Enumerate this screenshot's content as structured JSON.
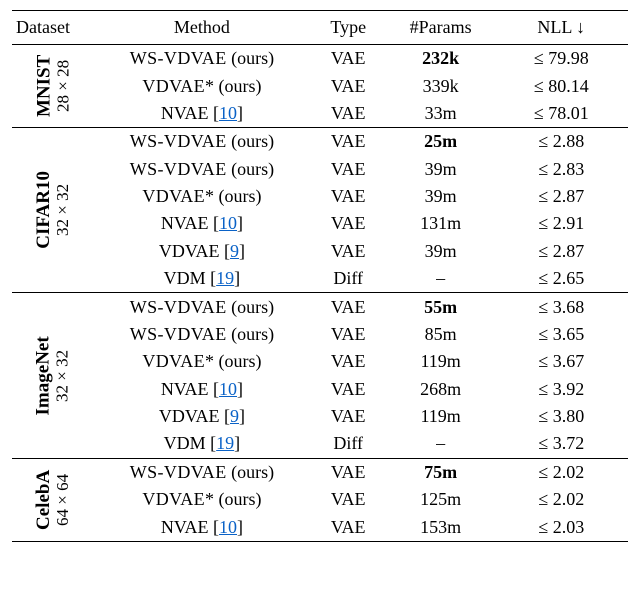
{
  "headers": {
    "dataset": "Dataset",
    "method": "Method",
    "type": "Type",
    "params": "#Params",
    "nll": "NLL ↓"
  },
  "cites": {
    "c9": "9",
    "c10": "10",
    "c19": "19"
  },
  "groups": [
    {
      "name": "MNIST",
      "size": "28 × 28",
      "rows": [
        {
          "method_prefix": "",
          "method_sc": "WS-VDVAE",
          "method_suffix": " (ours)",
          "cite": null,
          "type": "VAE",
          "params": "232k",
          "params_bold": true,
          "nll": "≤ 79.98"
        },
        {
          "method_prefix": "",
          "method_sc": "VDVAE",
          "method_suffix": "* (ours)",
          "cite": null,
          "type": "VAE",
          "params": "339k",
          "params_bold": false,
          "nll": "≤ 80.14"
        },
        {
          "method_prefix": "NVAE [",
          "method_sc": "",
          "method_suffix": "]",
          "cite": "c10",
          "type": "VAE",
          "params": "33m",
          "params_bold": false,
          "nll": "≤ 78.01"
        }
      ]
    },
    {
      "name": "CIFAR10",
      "size": "32 × 32",
      "rows": [
        {
          "method_prefix": "",
          "method_sc": "WS-VDVAE",
          "method_suffix": " (ours)",
          "cite": null,
          "type": "VAE",
          "params": "25m",
          "params_bold": true,
          "nll": "≤ 2.88"
        },
        {
          "method_prefix": "",
          "method_sc": "WS-VDVAE",
          "method_suffix": " (ours)",
          "cite": null,
          "type": "VAE",
          "params": "39m",
          "params_bold": false,
          "nll": "≤ 2.83"
        },
        {
          "method_prefix": "",
          "method_sc": "VDVAE",
          "method_suffix": "* (ours)",
          "cite": null,
          "type": "VAE",
          "params": "39m",
          "params_bold": false,
          "nll": "≤ 2.87"
        },
        {
          "method_prefix": "NVAE [",
          "method_sc": "",
          "method_suffix": "]",
          "cite": "c10",
          "type": "VAE",
          "params": "131m",
          "params_bold": false,
          "nll": "≤ 2.91"
        },
        {
          "method_prefix": "VDVAE [",
          "method_sc": "",
          "method_suffix": "]",
          "cite": "c9",
          "type": "VAE",
          "params": "39m",
          "params_bold": false,
          "nll": "≤ 2.87"
        },
        {
          "method_prefix": "VDM [",
          "method_sc": "",
          "method_suffix": "]",
          "cite": "c19",
          "type": "Diff",
          "params": "–",
          "params_bold": false,
          "nll": "≤ 2.65"
        }
      ]
    },
    {
      "name": "ImageNet",
      "size": "32 × 32",
      "rows": [
        {
          "method_prefix": "",
          "method_sc": "WS-VDVAE",
          "method_suffix": " (ours)",
          "cite": null,
          "type": "VAE",
          "params": "55m",
          "params_bold": true,
          "nll": "≤ 3.68"
        },
        {
          "method_prefix": "",
          "method_sc": "WS-VDVAE",
          "method_suffix": " (ours)",
          "cite": null,
          "type": "VAE",
          "params": "85m",
          "params_bold": false,
          "nll": "≤ 3.65"
        },
        {
          "method_prefix": "",
          "method_sc": "VDVAE",
          "method_suffix": "* (ours)",
          "cite": null,
          "type": "VAE",
          "params": "119m",
          "params_bold": false,
          "nll": "≤ 3.67"
        },
        {
          "method_prefix": "NVAE [",
          "method_sc": "",
          "method_suffix": "]",
          "cite": "c10",
          "type": "VAE",
          "params": "268m",
          "params_bold": false,
          "nll": "≤ 3.92"
        },
        {
          "method_prefix": "VDVAE [",
          "method_sc": "",
          "method_suffix": "]",
          "cite": "c9",
          "type": "VAE",
          "params": "119m",
          "params_bold": false,
          "nll": "≤ 3.80"
        },
        {
          "method_prefix": "VDM [",
          "method_sc": "",
          "method_suffix": "]",
          "cite": "c19",
          "type": "Diff",
          "params": "–",
          "params_bold": false,
          "nll": "≤ 3.72"
        }
      ]
    },
    {
      "name": "CelebA",
      "size": "64 × 64",
      "rows": [
        {
          "method_prefix": "",
          "method_sc": "WS-VDVAE",
          "method_suffix": " (ours)",
          "cite": null,
          "type": "VAE",
          "params": "75m",
          "params_bold": true,
          "nll": "≤ 2.02"
        },
        {
          "method_prefix": "",
          "method_sc": "VDVAE",
          "method_suffix": "* (ours)",
          "cite": null,
          "type": "VAE",
          "params": "125m",
          "params_bold": false,
          "nll": "≤ 2.02"
        },
        {
          "method_prefix": "NVAE [",
          "method_sc": "",
          "method_suffix": "]",
          "cite": "c10",
          "type": "VAE",
          "params": "153m",
          "params_bold": false,
          "nll": "≤ 2.03"
        }
      ]
    }
  ]
}
